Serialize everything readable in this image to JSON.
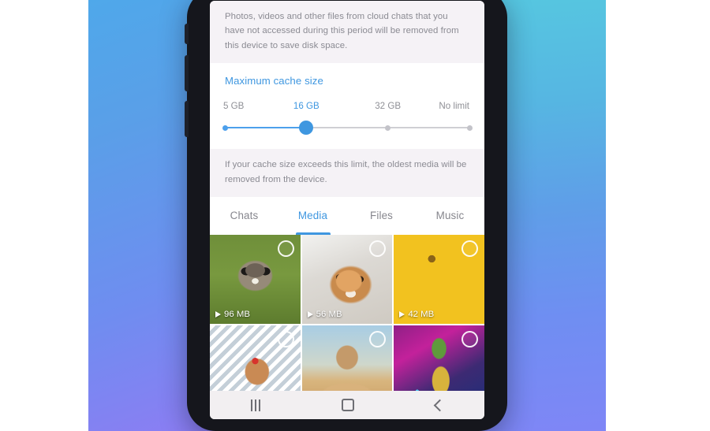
{
  "backdrop": {
    "gradient_left": "#4fa8ea",
    "gradient_mid": "#6f8df0",
    "gradient_right": "#ab86f5",
    "gradient_right_panel_top": "#56c8e0"
  },
  "theme": {
    "accent": "#3f97e0",
    "muted_text": "#8b8b93",
    "info_bg": "#f5f2f6",
    "screen_bg": "#ffffff",
    "navbar_bg": "#f2eff1"
  },
  "screen": {
    "top_info": {
      "text": "Photos, videos and other files from cloud chats that you have not accessed during this period will be removed from this device to save disk space."
    },
    "cache": {
      "title": "Maximum cache size",
      "options": [
        {
          "label": "5 GB",
          "active": false
        },
        {
          "label": "16 GB",
          "active": true
        },
        {
          "label": "32 GB",
          "active": false
        },
        {
          "label": "No limit",
          "active": false
        }
      ],
      "selected_index": 1,
      "selected_label": "16 GB"
    },
    "bottom_info": {
      "text": "If your cache size exceeds this limit, the oldest media will be removed from the device."
    },
    "tabs": [
      {
        "label": "Chats",
        "active": false
      },
      {
        "label": "Media",
        "active": true
      },
      {
        "label": "Files",
        "active": false
      },
      {
        "label": "Music",
        "active": false
      }
    ],
    "media_grid": [
      {
        "art": "art-raccoon",
        "icon": "play-icon",
        "size": "96 MB",
        "has_size": true,
        "checkbox": "unchecked-circle-icon"
      },
      {
        "art": "art-shiba",
        "icon": "play-icon",
        "size": "56 MB",
        "has_size": true,
        "checkbox": "unchecked-circle-icon"
      },
      {
        "art": "art-sunflower",
        "icon": "play-icon",
        "size": "42 MB",
        "has_size": true,
        "checkbox": "unchecked-circle-icon"
      },
      {
        "art": "art-reindeer",
        "icon": "",
        "size": "",
        "has_size": false,
        "checkbox": "unchecked-circle-icon"
      },
      {
        "art": "art-camel",
        "icon": "",
        "size": "",
        "has_size": false,
        "checkbox": "unchecked-circle-icon"
      },
      {
        "art": "art-pineapple",
        "icon": "",
        "size": "",
        "has_size": false,
        "checkbox": "unchecked-circle-icon"
      }
    ],
    "navbar": [
      {
        "name": "recents-icon"
      },
      {
        "name": "home-icon"
      },
      {
        "name": "back-icon"
      }
    ]
  }
}
